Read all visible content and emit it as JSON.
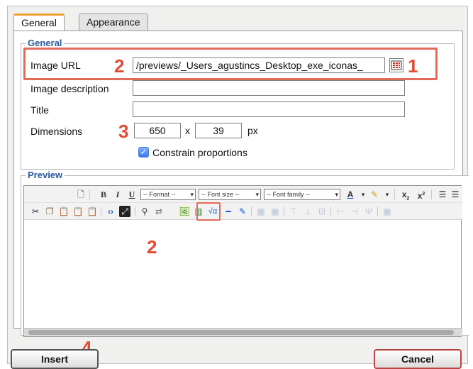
{
  "tabs": [
    {
      "label": "General",
      "active": true
    },
    {
      "label": "Appearance",
      "active": false
    }
  ],
  "general": {
    "legend": "General",
    "image_url_label": "Image URL",
    "image_url_value": "/previews/_Users_agustincs_Desktop_exe_iconas_",
    "description_label": "Image description",
    "description_value": "",
    "title_label": "Title",
    "title_value": "",
    "dimensions_label": "Dimensions",
    "width": "650",
    "times": "x",
    "height": "39",
    "unit": "px",
    "constrain_label": "Constrain proportions",
    "constrain_checked": true
  },
  "preview": {
    "legend": "Preview",
    "format_select": "-- Format --",
    "font_size_select": "-- Font size --",
    "font_family_select": "-- Font family --"
  },
  "callouts": [
    "1",
    "2",
    "3",
    "2",
    "4"
  ],
  "buttons": {
    "insert": "Insert",
    "cancel": "Cancel"
  },
  "colors": {
    "callout": "#e54a32",
    "legend": "#2a5a9c",
    "tab_accent": "#f0a030"
  }
}
